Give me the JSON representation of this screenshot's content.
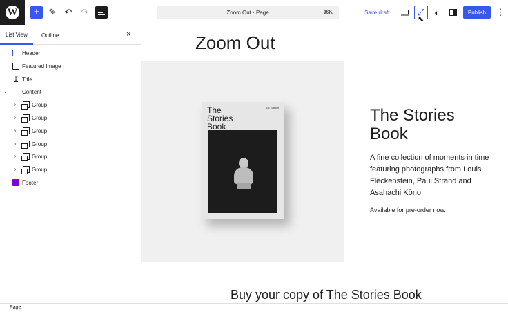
{
  "toolbar": {
    "logo_glyph": "W",
    "add_glyph": "+",
    "pen_glyph": "✎",
    "undo_glyph": "↶",
    "redo_glyph": "↷",
    "command_title": "Zoom Out · Page",
    "command_shortcut": "⌘K",
    "save_draft": "Save draft",
    "zoom_glyph": "⤢",
    "styles_glyph": "◐",
    "settings_glyph": "▣",
    "publish": "Publish",
    "more_glyph": "⋮",
    "accent": "#3858e9"
  },
  "sidebar": {
    "tabs": [
      "List View",
      "Outline"
    ],
    "close_glyph": "×",
    "items": [
      {
        "label": "Header",
        "icon": "header-icon"
      },
      {
        "label": "Featured Image",
        "icon": "featured-image-icon"
      },
      {
        "label": "Title",
        "icon": "title-icon",
        "glyph": "T"
      },
      {
        "label": "Content",
        "icon": "content-icon",
        "chevron": "⌄"
      },
      {
        "label": "Group",
        "icon": "group-icon",
        "chevron": "›"
      },
      {
        "label": "Group",
        "icon": "group-icon",
        "chevron": "›"
      },
      {
        "label": "Group",
        "icon": "group-icon",
        "chevron": "›"
      },
      {
        "label": "Group",
        "icon": "group-icon",
        "chevron": "›"
      },
      {
        "label": "Group",
        "icon": "group-icon",
        "chevron": "›"
      },
      {
        "label": "Group",
        "icon": "group-icon",
        "chevron": "›"
      },
      {
        "label": "Footer",
        "icon": "footer-icon"
      }
    ]
  },
  "canvas": {
    "page_title": "Zoom Out",
    "book_cover_title": "The Stories Book",
    "book_edition": "1st Edition",
    "heading": "The Stories Book",
    "description": "A fine collection of moments in time featuring photographs from Louis Fleckenstein, Paul Strand and Asahachi Kōno.",
    "availability": "Available for pre-order now.",
    "cta_heading": "Buy your copy of The Stories Book"
  },
  "status": {
    "breadcrumb": "Page"
  }
}
